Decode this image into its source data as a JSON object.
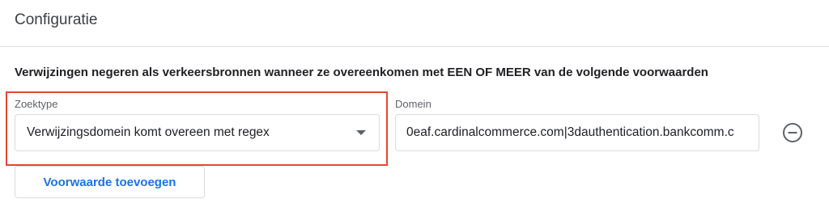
{
  "header": {
    "title": "Configuratie"
  },
  "instruction": "Verwijzingen negeren als verkeersbronnen wanneer ze overeenkomen met EEN OF MEER van de volgende voorwaarden",
  "condition": {
    "search_type_label": "Zoektype",
    "search_type_value": "Verwijzingsdomein komt overeen met regex",
    "domain_label": "Domein",
    "domain_value": "0eaf.cardinalcommerce.com|3dauthentication.bankcomm.c"
  },
  "actions": {
    "add_condition_label": "Voorwaarde toevoegen"
  },
  "colors": {
    "highlight_border": "#e5462f",
    "accent": "#1a73e8"
  },
  "icons": {
    "remove": "remove-circle-icon",
    "dropdown": "chevron-down-icon"
  }
}
